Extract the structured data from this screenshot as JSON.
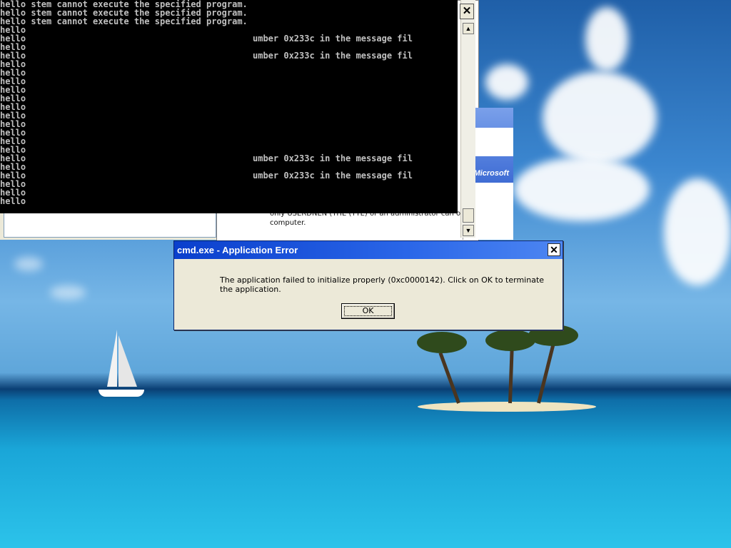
{
  "console": {
    "lines": [
      "hello stem cannot execute the specified program.",
      "hello stem cannot execute the specified program.",
      "hello stem cannot execute the specified program.",
      "hello",
      "hello                                            umber 0x233c in the message fil",
      "hello",
      "hello                                            umber 0x233c in the message fil",
      "hello",
      "hello",
      "hello",
      "hello",
      "hello",
      "hello",
      "hello",
      "hello",
      "hello",
      "hello",
      "hello",
      "hello                                            umber 0x233c in the message fil",
      "hello",
      "hello                                            umber 0x233c in the message fil",
      "hello",
      "hello",
      "hello"
    ]
  },
  "background_window": {
    "partial_text": "only USERDNEN (THE (YYE) or an administrator can on this computer.",
    "logo_text": "Microsoft"
  },
  "scrollbar": {
    "up_glyph": "▲",
    "down_glyph": "▼",
    "close_glyph": "✕"
  },
  "dialog": {
    "title": "cmd.exe - Application Error",
    "close_glyph": "✕",
    "message": "The application failed to initialize properly (0xc0000142). Click on OK to terminate the application.",
    "ok_label": "OK"
  },
  "colors": {
    "titlebar": "#0a3fcc",
    "dialog_bg": "#ece9d8",
    "console_bg": "#000000",
    "console_fg": "#c0c0c0"
  }
}
